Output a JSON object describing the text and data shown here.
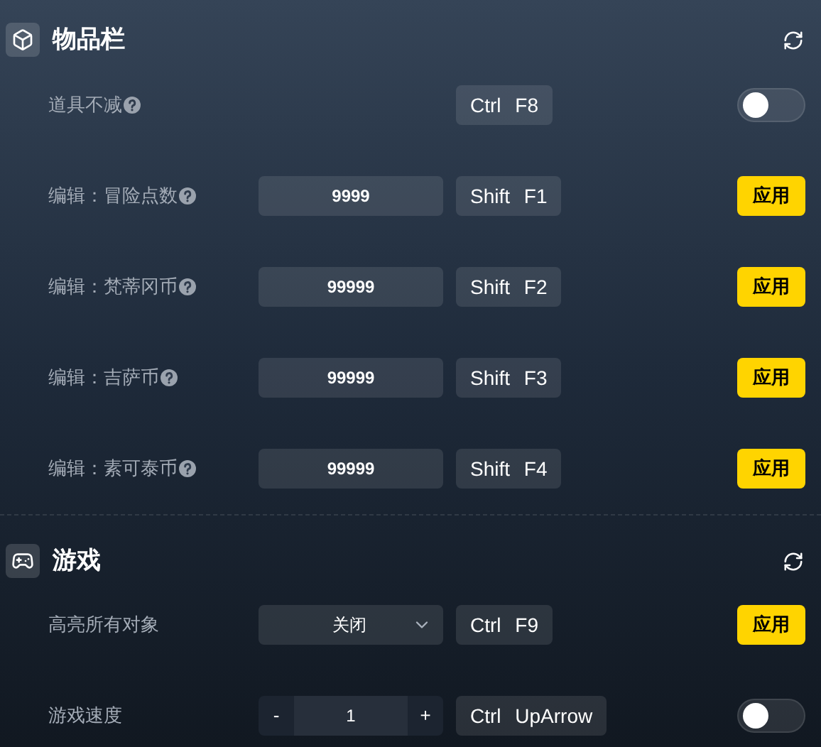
{
  "sections": [
    {
      "kind": "cube",
      "title": "物品栏",
      "rows": [
        {
          "kind": "toggle",
          "label": "道具不减",
          "help": true,
          "hotkey": "Ctrl F8",
          "on": false
        },
        {
          "kind": "input",
          "label": "编辑：冒险点数",
          "help": true,
          "value": "9999",
          "hotkey": "Shift F1",
          "button": "应用"
        },
        {
          "kind": "input",
          "label": "编辑：梵蒂冈币",
          "help": true,
          "value": "99999",
          "hotkey": "Shift F2",
          "button": "应用"
        },
        {
          "kind": "input",
          "label": "编辑：吉萨币",
          "help": true,
          "value": "99999",
          "hotkey": "Shift F3",
          "button": "应用"
        },
        {
          "kind": "input",
          "label": "编辑：素可泰币",
          "help": true,
          "value": "99999",
          "hotkey": "Shift F4",
          "button": "应用"
        }
      ]
    },
    {
      "kind": "gamepad",
      "title": "游戏",
      "rows": [
        {
          "kind": "select",
          "label": "高亮所有对象",
          "help": false,
          "value": "关闭",
          "hotkey": "Ctrl F9",
          "button": "应用"
        },
        {
          "kind": "stepper",
          "label": "游戏速度",
          "help": false,
          "value": "1",
          "minus": "-",
          "plus": "+",
          "hotkey": "Ctrl UpArrow",
          "on": false
        }
      ]
    }
  ]
}
